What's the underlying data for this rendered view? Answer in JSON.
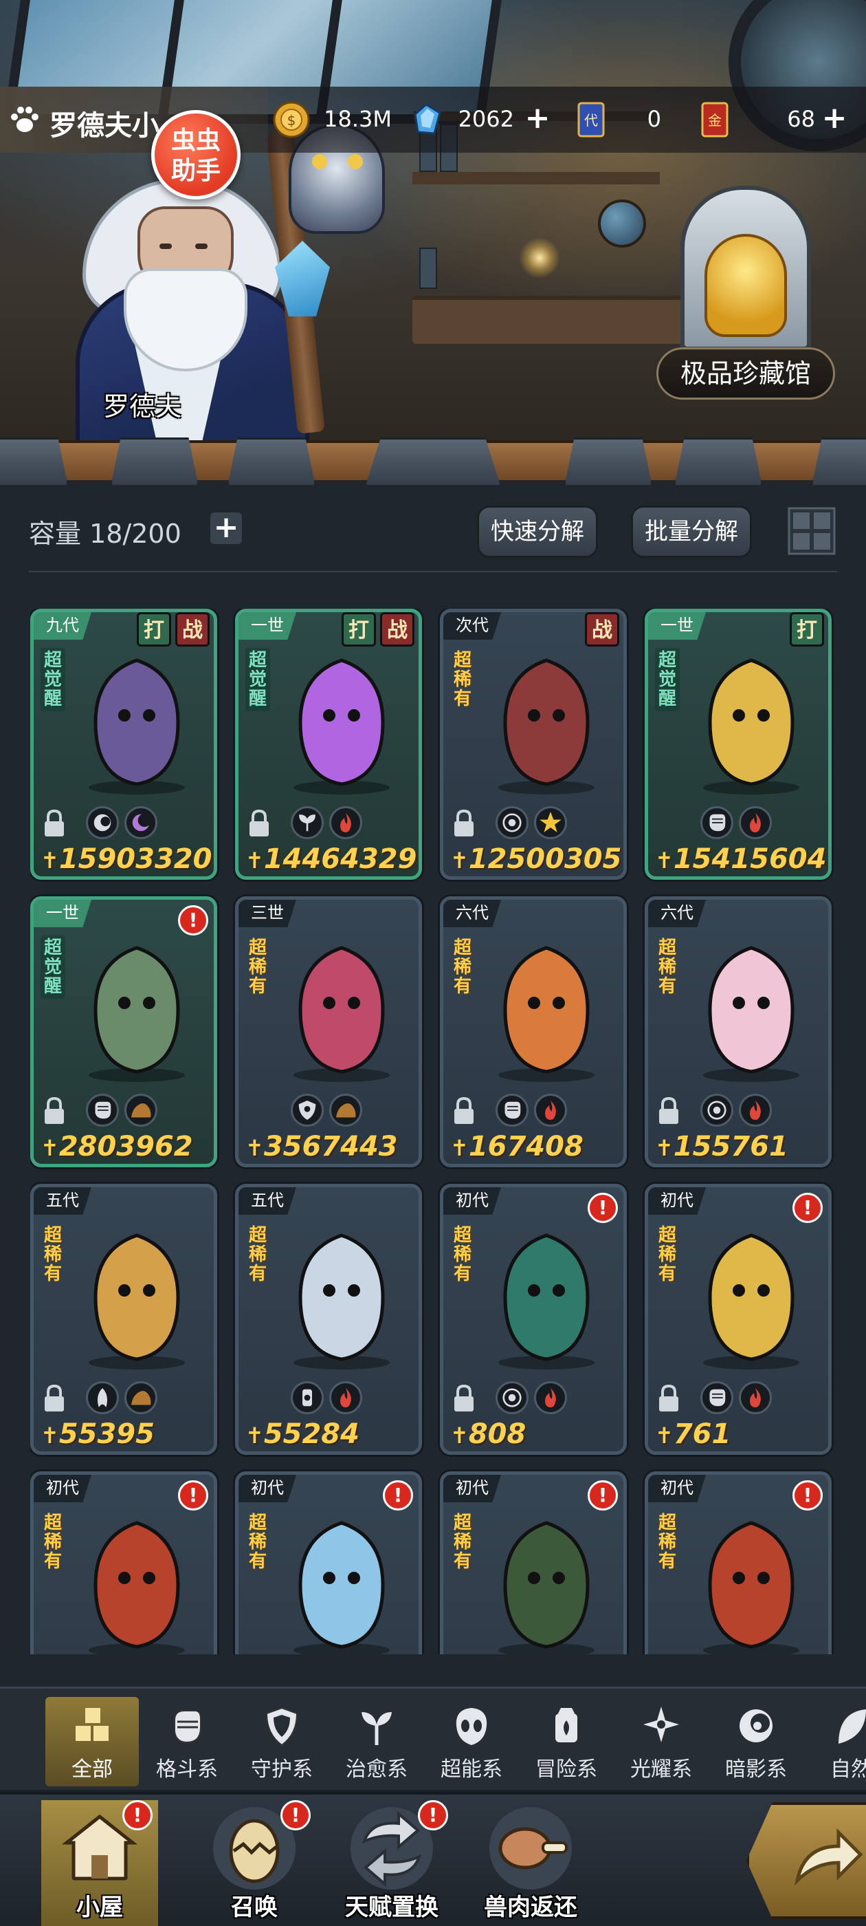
{
  "player": {
    "name": "罗德夫小",
    "helper_badge": [
      "虫虫",
      "助手"
    ]
  },
  "resources": [
    {
      "icon": "gold-coin-icon",
      "value": "18.3M",
      "has_plus": false
    },
    {
      "icon": "blue-crystal-icon",
      "value": "2062",
      "has_plus": true
    },
    {
      "icon": "generation-card-icon",
      "value": "0",
      "has_plus": false
    },
    {
      "icon": "gold-ticket-icon",
      "value": "68",
      "has_plus": true
    }
  ],
  "scene": {
    "character_name": "罗德夫",
    "treasure_hall_label": "极品珍藏馆"
  },
  "inventory": {
    "capacity_label": "容量 18/200",
    "quick_decompose": "快速分解",
    "batch_decompose": "批量分解"
  },
  "cards": [
    {
      "gen": "九代",
      "rarity": "超觉醒",
      "awakened": true,
      "tags": [
        "打",
        "战"
      ],
      "alert": false,
      "locked": true,
      "elements": [
        "shadow-element-icon",
        "moon-element-icon"
      ],
      "power": "15903320"
    },
    {
      "gen": "一世",
      "rarity": "超觉醒",
      "awakened": true,
      "tags": [
        "打",
        "战"
      ],
      "alert": false,
      "locked": true,
      "elements": [
        "leaf-element-icon",
        "fire-element-icon"
      ],
      "power": "14464329"
    },
    {
      "gen": "次代",
      "rarity": "超稀有",
      "awakened": false,
      "tags": [
        "战"
      ],
      "alert": false,
      "locked": true,
      "elements": [
        "psychic-element-icon",
        "light-element-icon"
      ],
      "power": "12500305"
    },
    {
      "gen": "一世",
      "rarity": "超觉醒",
      "awakened": true,
      "tags": [
        "打"
      ],
      "alert": false,
      "locked": false,
      "elements": [
        "fist-element-icon",
        "fire-element-icon"
      ],
      "power": "15415604"
    },
    {
      "gen": "一世",
      "rarity": "超觉醒",
      "awakened": true,
      "tags": [],
      "alert": true,
      "locked": true,
      "elements": [
        "fist-element-icon",
        "earth-element-icon"
      ],
      "power": "2803962"
    },
    {
      "gen": "三世",
      "rarity": "超稀有",
      "awakened": false,
      "tags": [],
      "alert": false,
      "locked": false,
      "elements": [
        "shield-element-icon",
        "earth-element-icon"
      ],
      "power": "3567443"
    },
    {
      "gen": "六代",
      "rarity": "超稀有",
      "awakened": false,
      "tags": [],
      "alert": false,
      "locked": true,
      "elements": [
        "fist-element-icon",
        "fire-element-icon"
      ],
      "power": "167408"
    },
    {
      "gen": "六代",
      "rarity": "超稀有",
      "awakened": false,
      "tags": [],
      "alert": false,
      "locked": true,
      "elements": [
        "psychic-element-icon",
        "fire-element-icon"
      ],
      "power": "155761"
    },
    {
      "gen": "五代",
      "rarity": "超稀有",
      "awakened": false,
      "tags": [],
      "alert": false,
      "locked": true,
      "elements": [
        "wind-element-icon",
        "earth-element-icon"
      ],
      "power": "55395"
    },
    {
      "gen": "五代",
      "rarity": "超稀有",
      "awakened": false,
      "tags": [],
      "alert": false,
      "locked": false,
      "elements": [
        "adventure-element-icon",
        "fire-element-icon"
      ],
      "power": "55284"
    },
    {
      "gen": "初代",
      "rarity": "超稀有",
      "awakened": false,
      "tags": [],
      "alert": true,
      "locked": true,
      "elements": [
        "psychic-element-icon",
        "fire-element-icon"
      ],
      "power": "808"
    },
    {
      "gen": "初代",
      "rarity": "超稀有",
      "awakened": false,
      "tags": [],
      "alert": true,
      "locked": true,
      "elements": [
        "fist-element-icon",
        "fire-element-icon"
      ],
      "power": "761"
    },
    {
      "gen": "初代",
      "rarity": "超稀有",
      "awakened": false,
      "tags": [],
      "alert": true,
      "locked": false,
      "elements": [],
      "power": ""
    },
    {
      "gen": "初代",
      "rarity": "超稀有",
      "awakened": false,
      "tags": [],
      "alert": true,
      "locked": false,
      "elements": [],
      "power": ""
    },
    {
      "gen": "初代",
      "rarity": "超稀有",
      "awakened": false,
      "tags": [],
      "alert": true,
      "locked": false,
      "elements": [],
      "power": ""
    },
    {
      "gen": "初代",
      "rarity": "超稀有",
      "awakened": false,
      "tags": [],
      "alert": true,
      "locked": false,
      "elements": [],
      "power": ""
    }
  ],
  "categories": [
    {
      "label": "全部",
      "icon": "all-blocks-icon",
      "active": true
    },
    {
      "label": "格斗系",
      "icon": "fist-icon",
      "active": false
    },
    {
      "label": "守护系",
      "icon": "shield-icon",
      "active": false
    },
    {
      "label": "治愈系",
      "icon": "sprout-icon",
      "active": false
    },
    {
      "label": "超能系",
      "icon": "alien-head-icon",
      "active": false
    },
    {
      "label": "冒险系",
      "icon": "lantern-icon",
      "active": false
    },
    {
      "label": "光耀系",
      "icon": "star-compass-icon",
      "active": false
    },
    {
      "label": "暗影系",
      "icon": "crescent-eye-icon",
      "active": false
    },
    {
      "label": "自然",
      "icon": "leaf-icon",
      "active": false
    }
  ],
  "nav": [
    {
      "label": "小屋",
      "icon": "house-icon",
      "alert": true,
      "active": true
    },
    {
      "label": "召唤",
      "icon": "egg-icon",
      "alert": true,
      "active": false
    },
    {
      "label": "天赋置换",
      "icon": "swap-arrows-icon",
      "alert": true,
      "active": false
    },
    {
      "label": "兽肉返还",
      "icon": "meat-icon",
      "alert": false,
      "active": false
    }
  ],
  "colors": {
    "awakened_border": "#3fa47f",
    "rare_text": "#ffcf4a",
    "power_text": "#ffd24d",
    "alert_red": "#d8281d",
    "active_tab_gold": "#8f7a39"
  }
}
